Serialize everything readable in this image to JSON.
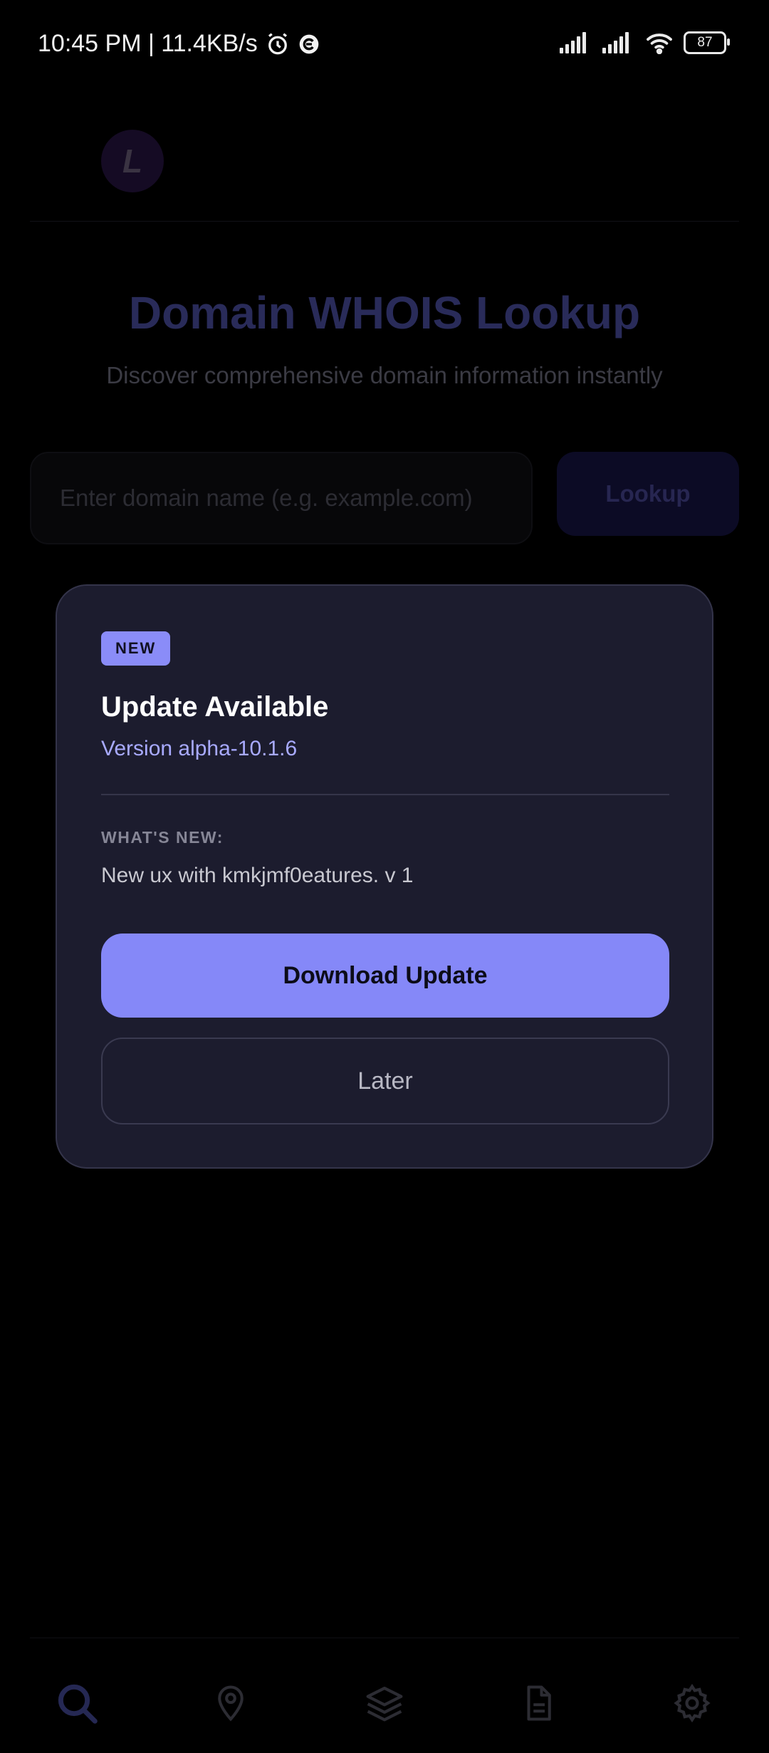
{
  "status_bar": {
    "time_speed": "10:45 PM | 11.4KB/s",
    "battery": "87"
  },
  "app": {
    "logo_letter": "L",
    "title": "Domain WHOIS Lookup",
    "subtitle": "Discover comprehensive domain information instantly",
    "search": {
      "placeholder": "Enter domain name (e.g. example.com)",
      "button_label": "Lookup"
    },
    "bottom_nav": [
      "search-icon",
      "location-pin-icon",
      "layers-icon",
      "document-icon",
      "gear-icon"
    ]
  },
  "dialog": {
    "badge": "NEW",
    "title": "Update Available",
    "version": "Version alpha-10.1.6",
    "whats_new_label": "WHAT'S NEW:",
    "whats_new_text": "New ux with kmkjmf0eatures. v 1",
    "download_label": "Download Update",
    "later_label": "Later"
  },
  "colors": {
    "background": "#000000",
    "dialog_bg": "#1c1c2e",
    "accent": "#8588f8",
    "version_text": "#a8aaff"
  }
}
